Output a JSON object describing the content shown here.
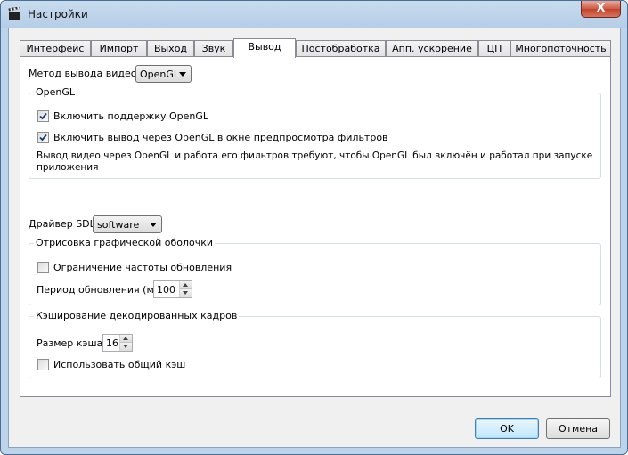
{
  "window": {
    "title": "Настройки",
    "close_label": "X"
  },
  "tabs": [
    "Интерфейс",
    "Импорт",
    "Выход",
    "Звук",
    "Вывод",
    "Постобработка",
    "Апп. ускорение",
    "ЦП",
    "Многопоточность"
  ],
  "active_tab": "Вывод",
  "video_output": {
    "label": "Метод вывода видео:",
    "value": "OpenGL"
  },
  "opengl_group": {
    "title": "OpenGL",
    "enable_label": "Включить поддержку OpenGL",
    "enable_checked": true,
    "filter_preview_label": "Включить вывод через OpenGL в окне предпросмотра фильтров",
    "filter_preview_checked": true,
    "note_line1": "Вывод видео через OpenGL и работа его фильтров требуют, чтобы OpenGL был включён и работал при запуске",
    "note_line2": "приложения"
  },
  "sdl_driver": {
    "label": "Драйвер SDL",
    "value": "software"
  },
  "shell_group": {
    "title": "Отрисовка графической оболочки",
    "limit_label": "Ограничение частоты обновления",
    "limit_checked": false,
    "period_label": "Период обновления (мс)",
    "period_value": "100"
  },
  "cache_group": {
    "title": "Кэширование декодированных кадров",
    "size_label": "Размер кэша:",
    "size_value": "16",
    "shared_label": "Использовать общий кэш",
    "shared_checked": false
  },
  "buttons": {
    "ok": "OK",
    "cancel": "Отмена"
  }
}
